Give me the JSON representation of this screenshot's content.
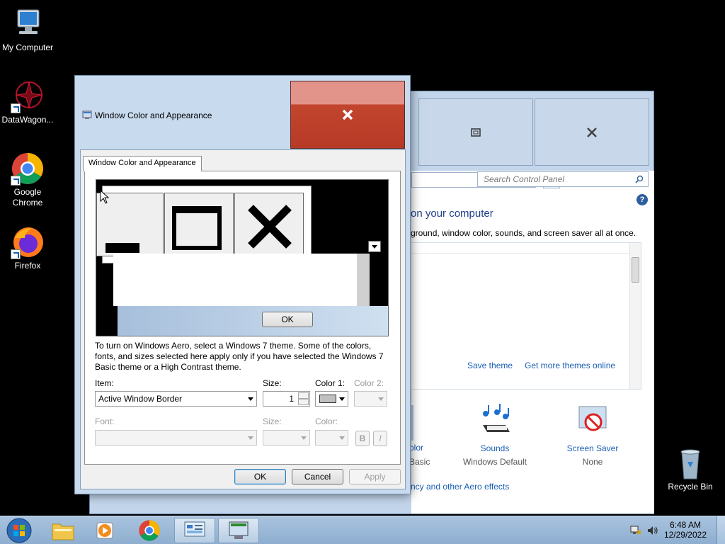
{
  "desktop": {
    "icons": [
      {
        "label": "My Computer"
      },
      {
        "label": "DataWagon..."
      },
      {
        "label": "Google Chrome"
      },
      {
        "label": "Firefox"
      },
      {
        "label": "Recycle Bin"
      }
    ]
  },
  "control_panel": {
    "search_placeholder": "Search Control Panel",
    "heading": "on your computer",
    "subtext": "ground, window color, sounds, and screen saver all at once.",
    "save_theme": "Save theme",
    "get_more_themes": "Get more themes online",
    "items": [
      {
        "label": "olor",
        "sub": "Basic"
      },
      {
        "label": "Sounds",
        "sub": "Windows Default"
      },
      {
        "label": "Screen Saver",
        "sub": "None"
      }
    ],
    "bottom_link": "ncy and other Aero effects",
    "help_glyph": "?"
  },
  "dialog": {
    "title": "Window Color and Appearance",
    "tab_label": "Window Color and Appearance",
    "preview_ok": "OK",
    "description": "To turn on Windows Aero, select a Windows 7 theme.  Some of the colors, fonts, and sizes selected here apply only if you have selected the Windows 7 Basic theme or a High Contrast theme.",
    "item_label": "Item:",
    "item_value": "Active Window Border",
    "size_label": "Size:",
    "size_value": "1",
    "color1_label": "Color 1:",
    "color1_value": "#c0c0c0",
    "color2_label": "Color 2:",
    "font_label": "Font:",
    "font_size_label": "Size:",
    "font_color_label": "Color:",
    "bold_label": "B",
    "italic_label": "I",
    "ok_label": "OK",
    "cancel_label": "Cancel",
    "apply_label": "Apply"
  },
  "taskbar": {
    "time": "6:48 AM",
    "date": "12/29/2022"
  },
  "colors": {
    "accent_link": "#1a5fb4",
    "close_red": "#c2452e",
    "desktop": "#000000"
  }
}
